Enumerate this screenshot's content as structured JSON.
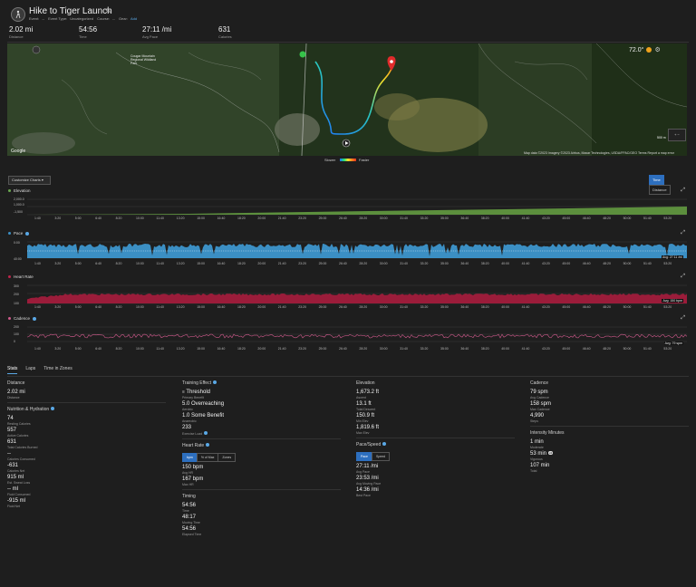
{
  "header": {
    "title": "Hike to Tiger Launch",
    "event_label": "Event:",
    "event_value": "--",
    "event_type_label": "Event Type:",
    "event_type_value": "Uncategorized",
    "course_label": "Course:",
    "course_value": "--",
    "gear_label": "Gear:",
    "gear_link": "Add"
  },
  "summary": [
    {
      "value": "2.02 mi",
      "label": "Distance"
    },
    {
      "value": "54:56",
      "label": "Time"
    },
    {
      "value": "27:11 /mi",
      "label": "Avg Pace"
    },
    {
      "value": "631",
      "label": "Calories"
    }
  ],
  "map": {
    "weather": "72.0°",
    "legend_slower": "Slower",
    "legend_faster": "Faster",
    "attribution": "Map data ©2023 Imagery ©2023 Airbus, Maxar Technologies, USDA/FPAC/GEO   Terms   Report a map error",
    "google_label": "Google",
    "scale_label": "500 m",
    "park_label": "Cougar Mountain Regional Wildland Park",
    "colors": {
      "track_start": "#1e6fff",
      "track_end": "#f4e22a",
      "pin": "#e02b2b",
      "start_marker": "#36c24a"
    }
  },
  "charts": {
    "customize_label": "Customize Charts",
    "toggle_time": "Time",
    "toggle_distance": "Distance",
    "time_ticks": [
      "1:40",
      "3:20",
      "5:00",
      "6:40",
      "8:20",
      "10:00",
      "11:40",
      "13:20",
      "15:00",
      "16:40",
      "18:20",
      "20:00",
      "21:40",
      "23:20",
      "25:00",
      "26:40",
      "28:20",
      "30:00",
      "31:40",
      "33:20",
      "35:00",
      "36:40",
      "38:20",
      "40:00",
      "41:40",
      "43:20",
      "45:00",
      "46:40",
      "48:20",
      "50:00",
      "51:40",
      "53:20"
    ],
    "elevation": {
      "title": "Elevation",
      "y_ticks": [
        "2,000.0",
        "1,000.0",
        "-1,500"
      ],
      "color": "#6aa84f"
    },
    "pace": {
      "title": "Pace",
      "y_ticks": [
        "0:00",
        "20:00",
        "40:00"
      ],
      "avg": "Avg: 27:11 /mi",
      "color": "#3b8fc4"
    },
    "heart_rate": {
      "title": "Heart Rate",
      "y_ticks": [
        "300",
        "200",
        "100"
      ],
      "avg": "Avg: 150 bpm",
      "color": "#c0254a"
    },
    "cadence": {
      "title": "Cadence",
      "y_ticks": [
        "200",
        "150",
        "100",
        "50",
        "0"
      ],
      "avg": "Avg: 79 spm",
      "color": "#d05a8c"
    }
  },
  "tabs": [
    "Stats",
    "Laps",
    "Time in Zones"
  ],
  "stats": {
    "col1": {
      "distance_title": "Distance",
      "distance": {
        "value": "2.02 mi",
        "label": "Distance"
      },
      "nutrition_title": "Nutrition & Hydration",
      "items": [
        {
          "value": "74",
          "label": "Resting Calories"
        },
        {
          "value": "557",
          "label": "Active Calories"
        },
        {
          "value": "631",
          "label": "Total Calories Burned"
        },
        {
          "value": "--",
          "label": "Calories Consumed"
        },
        {
          "value": "-631",
          "label": "Calories Net"
        },
        {
          "value": "915 ml",
          "label": "Est. Sweat Loss"
        },
        {
          "value": "-- ml",
          "label": "Fluid Consumed"
        },
        {
          "value": "-915 ml",
          "label": "Fluid Net"
        }
      ]
    },
    "col2": {
      "training_title": "Training Effect",
      "training": [
        {
          "value": "Threshold",
          "label": "Primary Benefit"
        },
        {
          "value": "5.0 Overreaching",
          "label": "Aerobic"
        },
        {
          "value": "1.0 Some Benefit",
          "label": "Anaerobic"
        },
        {
          "value": "233",
          "label": "Exercise Load"
        }
      ],
      "hr_title": "Heart Rate",
      "hr_buttons": [
        "bpm",
        "% of Max",
        "Zones"
      ],
      "hr": [
        {
          "value": "150 bpm",
          "label": "Avg HR"
        },
        {
          "value": "167 bpm",
          "label": "Max HR"
        }
      ],
      "timing_title": "Timing",
      "timing": [
        {
          "value": "54:56",
          "label": "Time"
        },
        {
          "value": "48:17",
          "label": "Moving Time"
        },
        {
          "value": "54:56",
          "label": "Elapsed Time"
        }
      ]
    },
    "col3": {
      "elevation_title": "Elevation",
      "elevation": [
        {
          "value": "1,673.2 ft",
          "label": "Ascent"
        },
        {
          "value": "13.1 ft",
          "label": "Total Descent"
        },
        {
          "value": "150.9 ft",
          "label": "Min Elev"
        },
        {
          "value": "1,819.6 ft",
          "label": "Max Elev"
        }
      ],
      "pace_title": "Pace/Speed",
      "pace_buttons": [
        "Pace",
        "Speed"
      ],
      "pace": [
        {
          "value": "27:11 /mi",
          "label": "Avg Pace"
        },
        {
          "value": "23:53 /mi",
          "label": "Avg Moving Pace"
        },
        {
          "value": "14:36 /mi",
          "label": "Best Pace"
        }
      ]
    },
    "col4": {
      "cadence_title": "Cadence",
      "cadence": [
        {
          "value": "79 spm",
          "label": "Avg Cadence"
        },
        {
          "value": "158 spm",
          "label": "Max Cadence"
        },
        {
          "value": "4,990",
          "label": "Steps"
        }
      ],
      "intensity_title": "Intensity Minutes",
      "intensity": [
        {
          "value": "1 min",
          "label": "Moderate"
        },
        {
          "value": "53 min",
          "label": "Vigorous"
        },
        {
          "value": "107 min",
          "label": "Total"
        }
      ]
    }
  }
}
